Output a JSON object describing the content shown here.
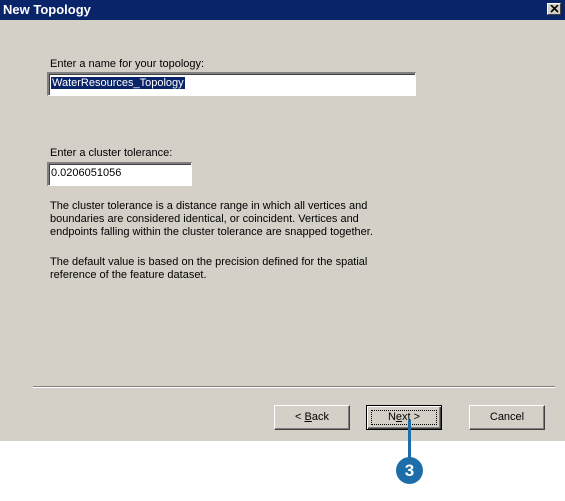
{
  "window": {
    "title": "New Topology",
    "close_icon": "close-icon"
  },
  "name_section": {
    "label": "Enter a name for your topology:",
    "value": "WaterResources_Topology"
  },
  "tolerance_section": {
    "label": "Enter a cluster tolerance:",
    "value": "0.0206051056"
  },
  "description": {
    "paragraph1": "The cluster tolerance is a distance range in which all vertices and\nboundaries are considered identical, or coincident. Vertices and\nendpoints falling within the cluster tolerance are snapped together.",
    "paragraph2": "The default value is based on the precision defined for the spatial\nreference of the feature dataset."
  },
  "buttons": {
    "back_prefix": "< ",
    "back_mnemonic": "B",
    "back_rest": "ack",
    "next_prefix": "N",
    "next_mnemonic": "e",
    "next_rest": "xt >",
    "cancel": "Cancel"
  },
  "callout": {
    "number": "3",
    "color": "#1d6ea8"
  },
  "colors": {
    "titlebar": "#0a246a",
    "dialog_face": "#d4d0c8"
  }
}
